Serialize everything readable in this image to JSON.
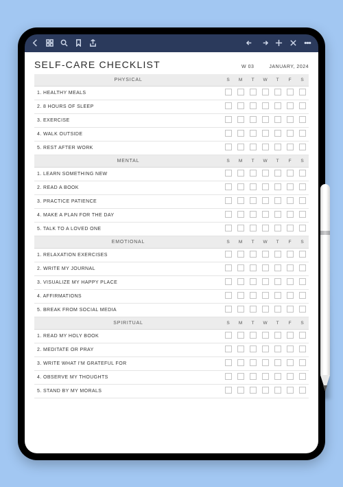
{
  "header": {
    "title": "SELF-CARE CHECKLIST",
    "week": "W 03",
    "month": "JANUARY, 2024"
  },
  "days": [
    "S",
    "M",
    "T",
    "W",
    "T",
    "F",
    "S"
  ],
  "sections": [
    {
      "name": "PHYSICAL",
      "items": [
        "1. HEALTHY MEALS",
        "2. 8 HOURS OF SLEEP",
        "3. EXERCISE",
        "4. WALK OUTSIDE",
        "5. REST AFTER WORK"
      ]
    },
    {
      "name": "MENTAL",
      "items": [
        "1. LEARN SOMETHING NEW",
        "2. READ A BOOK",
        "3. PRACTICE PATIENCE",
        "4. MAKE A PLAN FOR THE DAY",
        "5. TALK TO A LOVED ONE"
      ]
    },
    {
      "name": "EMOTIONAL",
      "items": [
        "1. RELAXATION EXERCISES",
        "2. WRITE MY JOURNAL",
        "3. VISUALIZE MY HAPPY PLACE",
        "4. AFFIRMATIONS",
        "5. BREAK FROM SOCIAL MEDIA"
      ]
    },
    {
      "name": "SPIRITUAL",
      "items": [
        "1. READ MY HOLY BOOK",
        "2. MEDITATE OR PRAY",
        "3. WRITE WHAT I'M GRATEFUL FOR",
        "4. OBSERVE MY THOUGHTS",
        "5. STAND BY MY MORALS"
      ]
    }
  ],
  "toolbar": {
    "left": [
      "back",
      "grid",
      "search",
      "bookmark",
      "share"
    ],
    "right": [
      "undo",
      "redo",
      "add",
      "close",
      "more"
    ]
  }
}
